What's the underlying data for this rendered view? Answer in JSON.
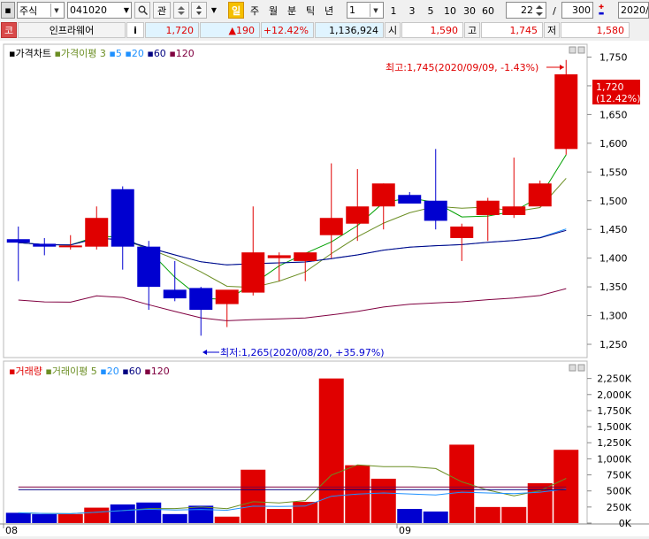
{
  "toolbar": {
    "market_type": "주식",
    "stock_code": "041020",
    "watch_label": "관",
    "period_highlight": "일",
    "periods": [
      "주",
      "월",
      "분",
      "틱",
      "년"
    ],
    "interval_value": "1",
    "intervals": [
      "1",
      "3",
      "5",
      "10",
      "30",
      "60"
    ],
    "count_value": "22",
    "separator": "/",
    "total_value": "300",
    "date_value": "2020/0"
  },
  "info": {
    "market_badge": "코",
    "stock_name": "인프라웨어",
    "info_icon": "i",
    "price": "1,720",
    "change": "▲190",
    "change_pct": "+12.42%",
    "volume": "1,136,924",
    "open_label": "시",
    "open_value": "1,590",
    "high_label": "고",
    "high_value": "1,745",
    "low_label": "저",
    "low_value": "1,580"
  },
  "price_panel": {
    "title": "가격차트",
    "ma_label": "가격이평",
    "ma_periods": [
      "3",
      "5",
      "20",
      "60",
      "120"
    ],
    "high_annotation": "최고:1,745(2020/09/09, -1.43%)",
    "low_annotation": "최저:1,265(2020/08/20, +35.97%)",
    "last_price_tag": "1,720",
    "last_pct_tag": "(12.42%)",
    "y_ticks": [
      "1,750",
      "1,700",
      "1,650",
      "1,600",
      "1,550",
      "1,500",
      "1,450",
      "1,400",
      "1,350",
      "1,300",
      "1,250"
    ]
  },
  "volume_panel": {
    "title": "거래량",
    "ma_label": "거래이평",
    "ma_periods": [
      "5",
      "20",
      "60",
      "120"
    ],
    "y_ticks": [
      "2,250K",
      "2,000K",
      "1,750K",
      "1,500K",
      "1,250K",
      "1,000K",
      "750K",
      "500K",
      "250K",
      "0K"
    ]
  },
  "x_axis": {
    "labels": [
      "08",
      "09"
    ]
  },
  "colors": {
    "up": "#e00000",
    "down": "#0000d0",
    "ma3": "#00a000",
    "ma5": "#6b8e23",
    "ma20": "#1e90ff",
    "ma60": "#000080",
    "ma120": "#800040"
  },
  "chart_data": {
    "type": "candlestick",
    "x": [
      "2020/08/10",
      "2020/08/11",
      "2020/08/12",
      "2020/08/13",
      "2020/08/14",
      "2020/08/18",
      "2020/08/19",
      "2020/08/20",
      "2020/08/21",
      "2020/08/24",
      "2020/08/25",
      "2020/08/26",
      "2020/08/27",
      "2020/08/28",
      "2020/08/31",
      "2020/09/01",
      "2020/09/02",
      "2020/09/03",
      "2020/09/04",
      "2020/09/07",
      "2020/09/08",
      "2020/09/09"
    ],
    "open": [
      1433,
      1425,
      1422,
      1420,
      1520,
      1420,
      1345,
      1348,
      1320,
      1340,
      1400,
      1395,
      1440,
      1460,
      1490,
      1510,
      1500,
      1435,
      1475,
      1475,
      1490,
      1590
    ],
    "high": [
      1455,
      1435,
      1440,
      1490,
      1525,
      1430,
      1395,
      1350,
      1340,
      1490,
      1410,
      1400,
      1565,
      1555,
      1530,
      1515,
      1590,
      1460,
      1505,
      1575,
      1535,
      1745
    ],
    "low": [
      1360,
      1405,
      1415,
      1415,
      1380,
      1310,
      1325,
      1265,
      1280,
      1335,
      1360,
      1360,
      1400,
      1430,
      1450,
      1495,
      1450,
      1395,
      1430,
      1470,
      1490,
      1580
    ],
    "close": [
      1427,
      1420,
      1422,
      1470,
      1420,
      1350,
      1330,
      1310,
      1345,
      1410,
      1405,
      1410,
      1470,
      1490,
      1530,
      1495,
      1465,
      1455,
      1500,
      1490,
      1530,
      1720
    ],
    "volume": [
      160,
      140,
      140,
      240,
      290,
      320,
      140,
      270,
      100,
      830,
      220,
      330,
      2250,
      900,
      690,
      220,
      180,
      1220,
      250,
      250,
      620,
      1140
    ],
    "volume_unit": "K",
    "ylim": [
      1230,
      1760
    ],
    "volume_ylim": [
      0,
      2300
    ]
  }
}
